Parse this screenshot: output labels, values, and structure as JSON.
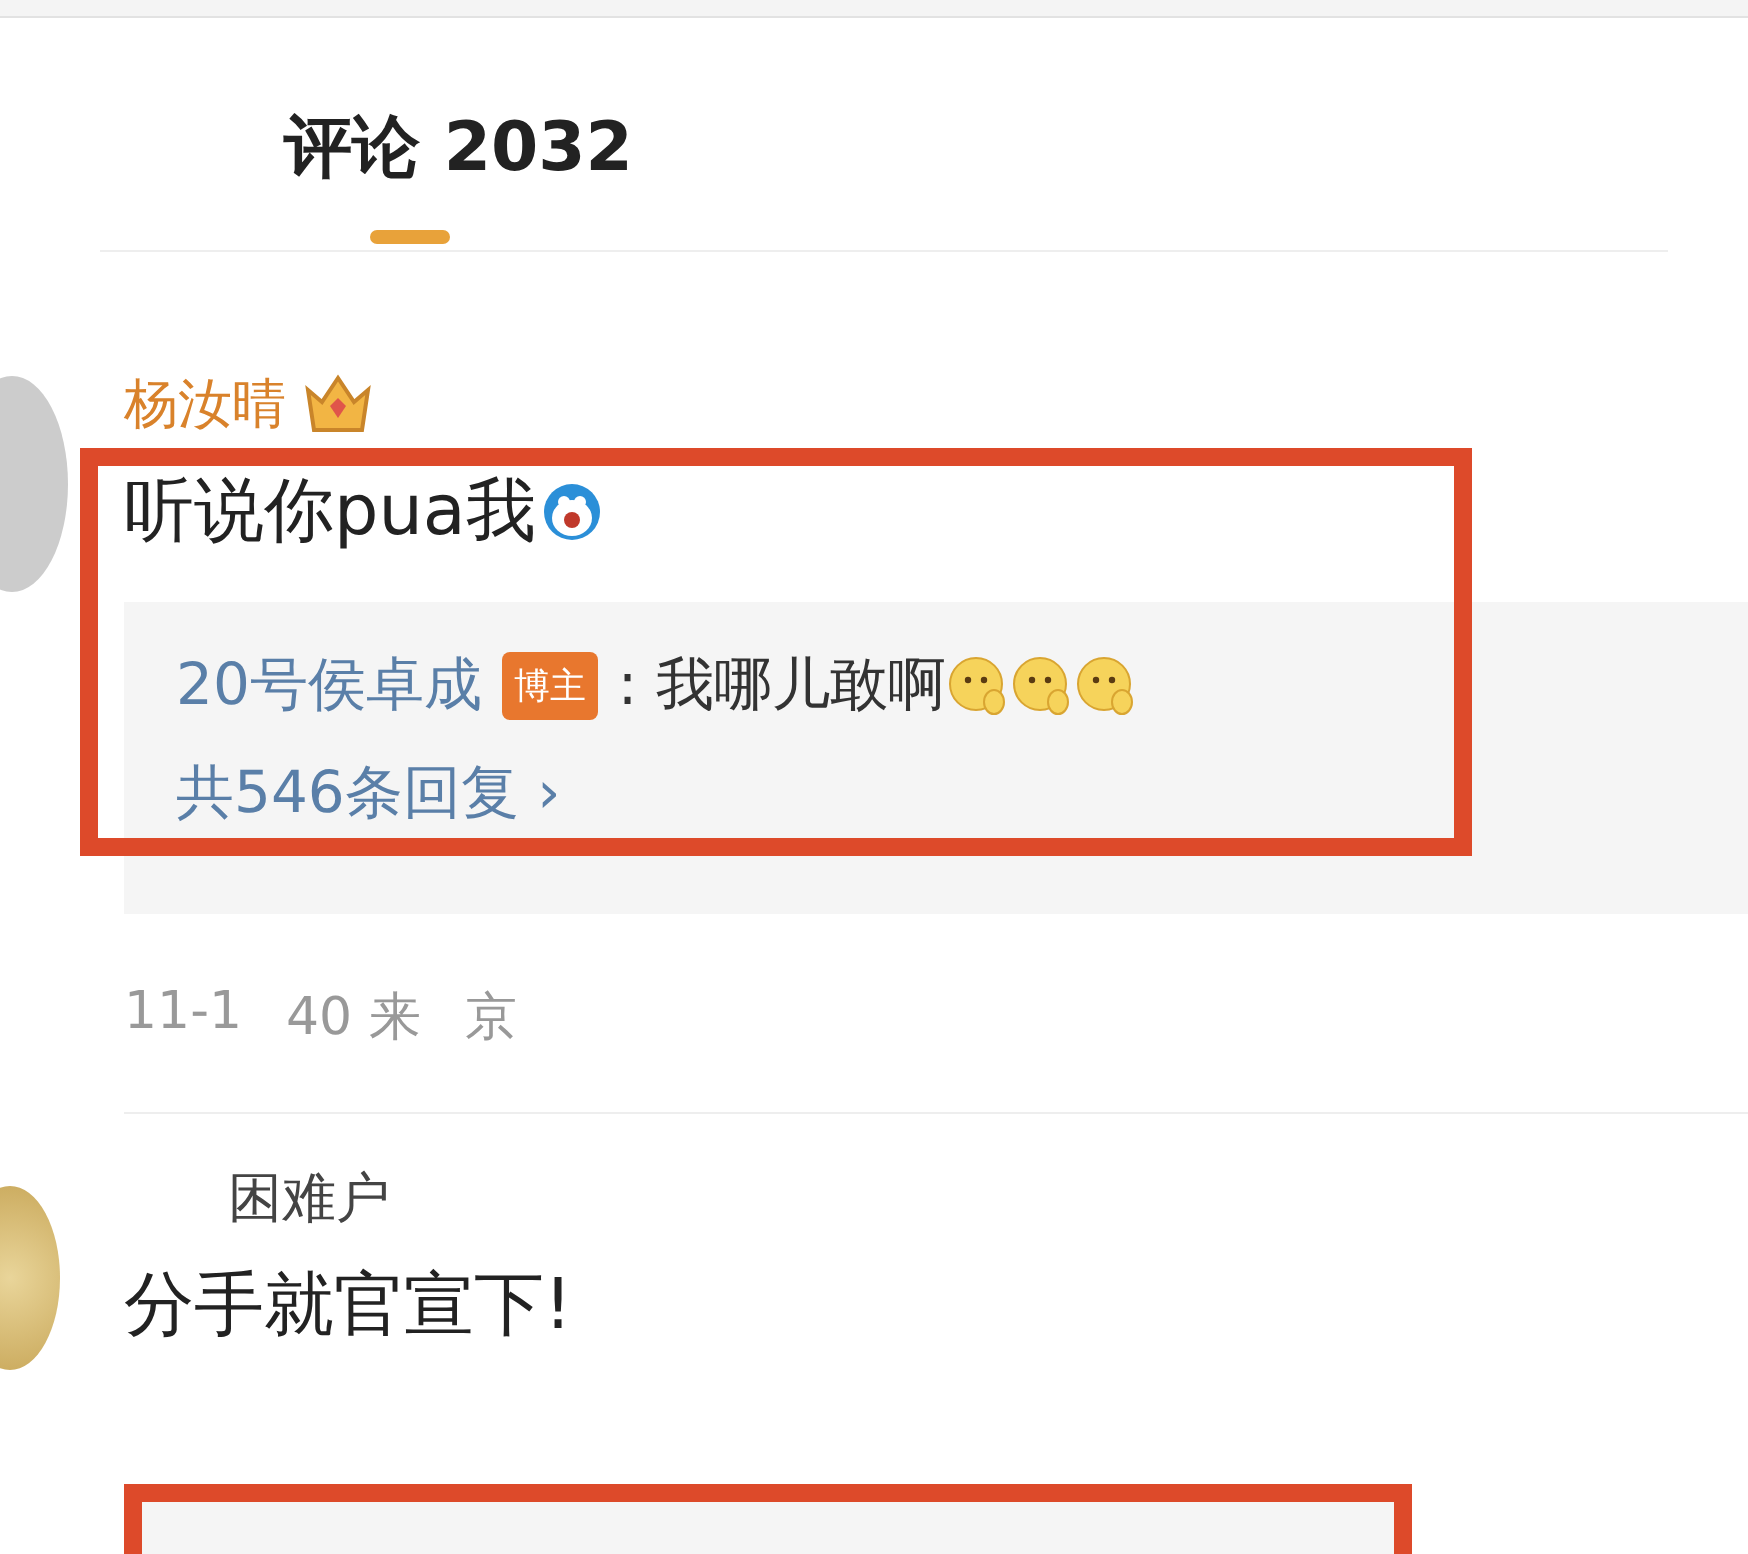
{
  "tabs": [
    {
      "label": "评论 2032",
      "selected": true
    }
  ],
  "comments": [
    {
      "author": "杨汝晴",
      "crown": true,
      "text": "听说你pua我",
      "emojis": [
        {
          "kind": "doraemon"
        }
      ],
      "highlighted": true,
      "reply": {
        "author": "20号侯卓成",
        "badge": "博主",
        "separator": ":",
        "text": "我哪儿敢啊",
        "emojis": [
          {
            "kind": "smile"
          },
          {
            "kind": "smile"
          },
          {
            "kind": "smile"
          }
        ],
        "more": "共546条回复",
        "arrow": "›"
      },
      "meta": [
        "11-1",
        "40 来",
        "京"
      ]
    },
    {
      "author": "困难户",
      "crown": false,
      "text": "分手就官宣下!",
      "highlighted": false,
      "next_highlighted": true
    }
  ]
}
